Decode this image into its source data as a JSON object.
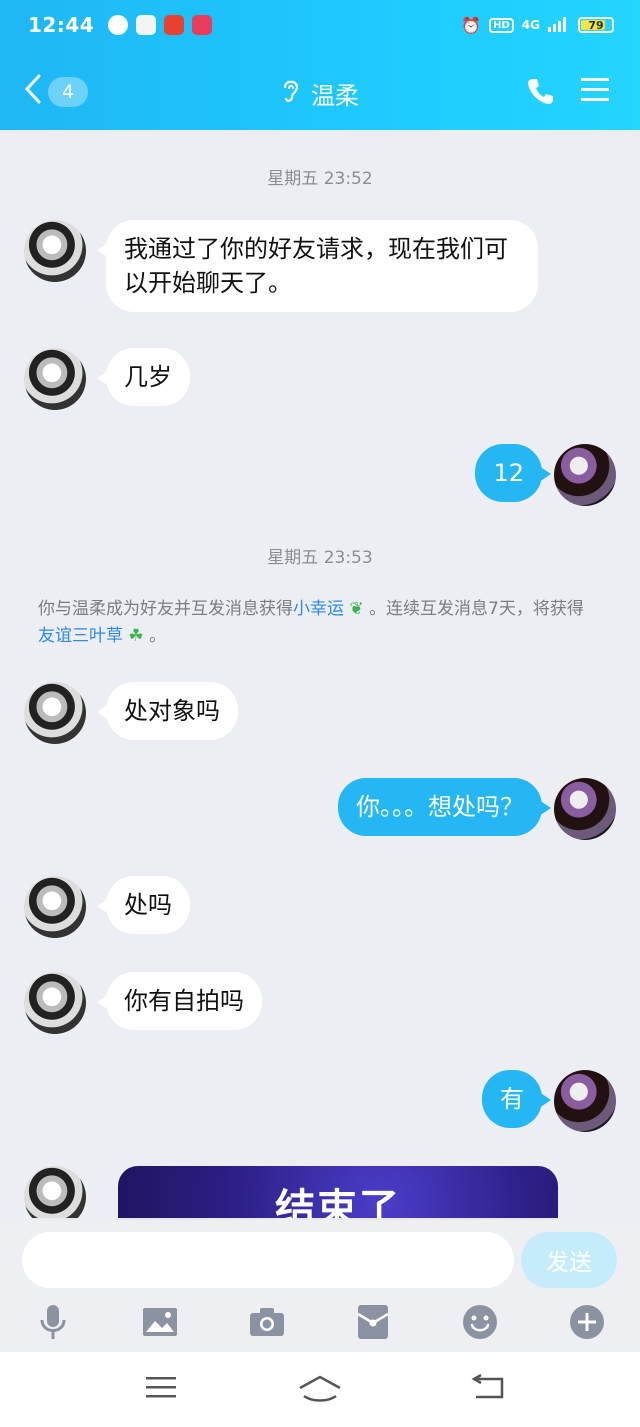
{
  "status_bar": {
    "time": "12:44",
    "network": "4G",
    "hd": "HD",
    "battery": "79",
    "battery_level": 0.79
  },
  "header": {
    "back_count": "4",
    "title": "温柔"
  },
  "messages": {
    "ts1": "星期五  23:52",
    "m1": "我通过了你的好友请求，现在我们可以开始聊天了。",
    "m2": "几岁",
    "m3": "12",
    "ts2": "星期五  23:53",
    "notice_part1": "你与温柔成为好友并互发消息获得",
    "notice_link1": "小幸运",
    "notice_part2": "。连续互发消息7天，将获得",
    "notice_link2": "友谊三叶草",
    "notice_part3": "。",
    "m4": "处对象吗",
    "m5": "你。。。想处吗？",
    "m6": "处吗",
    "m7": "你有自拍吗",
    "m8": "有",
    "card_text": "结束了"
  },
  "input": {
    "placeholder": "",
    "send_label": "发送"
  },
  "toolbar": [
    "mic-icon",
    "image-icon",
    "camera-icon",
    "red-packet-icon",
    "emoji-icon",
    "plus-icon"
  ],
  "colors": {
    "accent": "#1ec9ff",
    "bubble_out": "#25b7f3",
    "link": "#2a8be0"
  }
}
